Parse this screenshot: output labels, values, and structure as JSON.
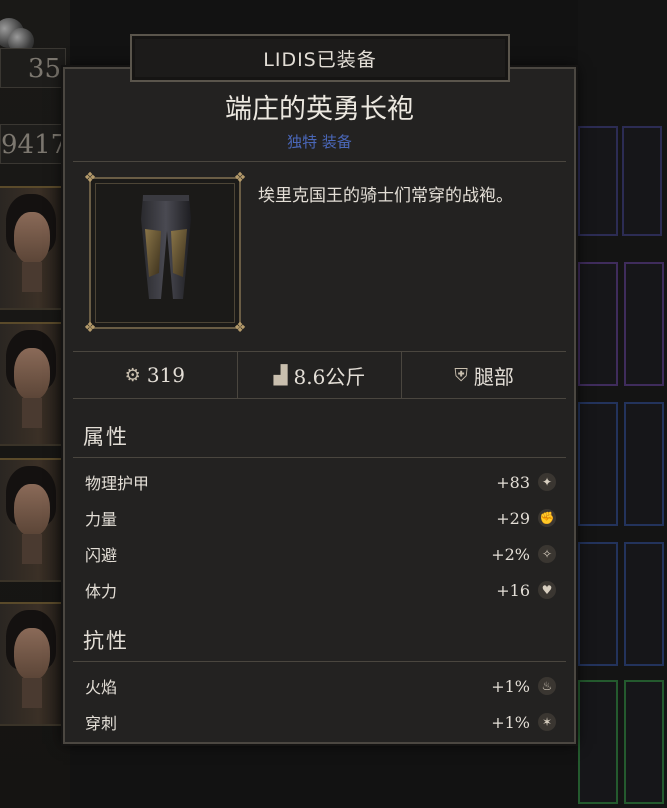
{
  "background": {
    "left_stats": [
      "35",
      "9417"
    ]
  },
  "tooltip": {
    "header": "LIDIS已装备",
    "item_name": "端庄的英勇长袍",
    "item_subtitle": "独特 装备",
    "description": "埃里克国王的骑士们常穿的战袍。",
    "stats": {
      "value": "319",
      "weight": "8.6公斤",
      "slot": "腿部"
    },
    "attributes_title": "属性",
    "attributes": [
      {
        "label": "物理护甲",
        "value": "+83",
        "icon": "armor-icon"
      },
      {
        "label": "力量",
        "value": "+29",
        "icon": "strength-icon"
      },
      {
        "label": "闪避",
        "value": "+2%",
        "icon": "dodge-icon"
      },
      {
        "label": "体力",
        "value": "+16",
        "icon": "heart-icon"
      }
    ],
    "resist_title": "抗性",
    "resistances": [
      {
        "label": "火焰",
        "value": "+1%",
        "icon": "fire-icon"
      },
      {
        "label": "穿刺",
        "value": "+1%",
        "icon": "pierce-icon"
      }
    ]
  },
  "colors": {
    "accent_blue": "#4a67b8",
    "panel_bg": "#232221",
    "frame_gold": "#b49a6a"
  }
}
